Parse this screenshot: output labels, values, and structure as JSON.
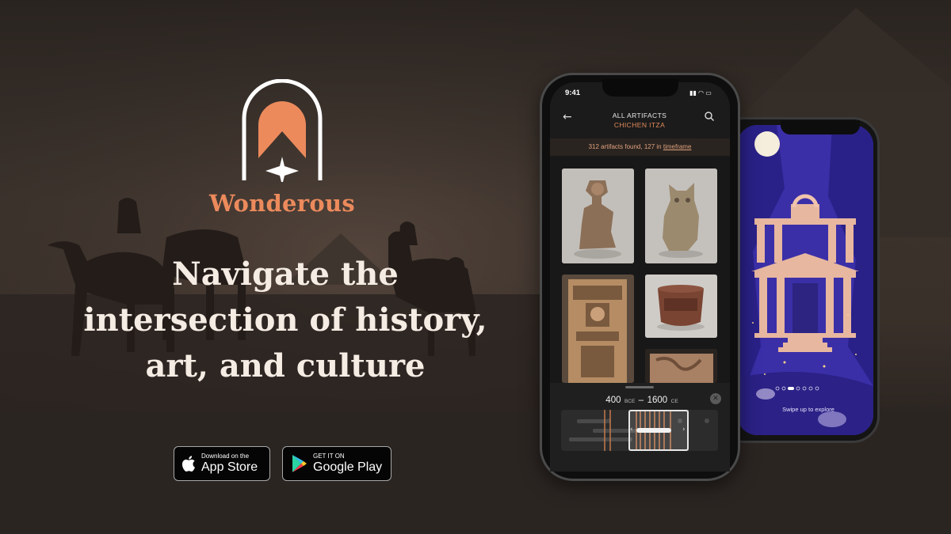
{
  "brand": {
    "name": "Wonderous",
    "accent_color": "#ec8a5c"
  },
  "hero": {
    "headline_lines": [
      "Navigate the",
      "intersection of history,",
      "art, and culture"
    ]
  },
  "store_badges": {
    "apple": {
      "small": "Download on the",
      "big": "App Store",
      "icon": "apple-icon"
    },
    "google": {
      "small": "GET IT ON",
      "big": "Google Play",
      "icon": "google-play-icon"
    }
  },
  "phone_front": {
    "status_time": "9:41",
    "header": {
      "title": "ALL ARTIFACTS",
      "subtitle": "CHICHEN ITZA",
      "back_icon": "back-arrow-icon",
      "search_icon": "search-icon"
    },
    "found_text_prefix": "312 artifacts found, 127 in ",
    "found_link": "timeframe",
    "timeline": {
      "start_value": "400",
      "start_era": "BCE",
      "separator": "–",
      "end_value": "1600",
      "end_era": "CE",
      "clear_icon": "close-icon"
    }
  },
  "phone_back": {
    "swipe_text": "Swipe up to explore",
    "page_dots": 6,
    "active_dot": 2
  },
  "colors": {
    "background": "#2f2824",
    "accent": "#ec8a5c",
    "back_screen": "#3a2f9c"
  }
}
